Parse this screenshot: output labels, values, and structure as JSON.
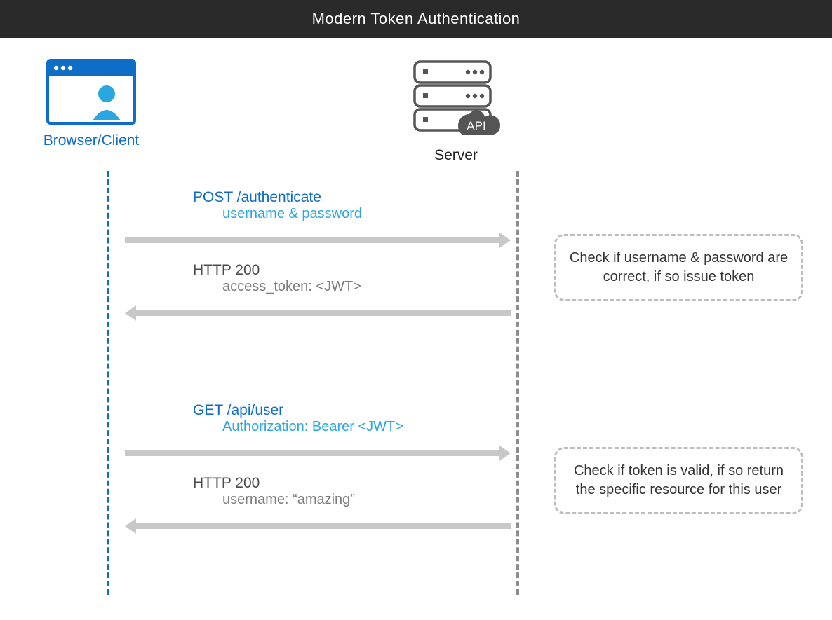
{
  "header": {
    "title": "Modern Token Authentication"
  },
  "actors": {
    "client": {
      "label": "Browser/Client"
    },
    "server": {
      "label": "Server",
      "api_badge": "API"
    }
  },
  "messages": {
    "req1": {
      "line1": "POST /authenticate",
      "line2": "username & password"
    },
    "res1": {
      "line1": "HTTP 200",
      "line2": "access_token: <JWT>"
    },
    "req2": {
      "line1": "GET /api/user",
      "line2": "Authorization: Bearer <JWT>"
    },
    "res2": {
      "line1": "HTTP 200",
      "line2": "username: “amazing”"
    }
  },
  "notes": {
    "note1": "Check if username & password are correct, if so issue token",
    "note2": "Check if token is valid, if so return the specific resource for this user"
  }
}
